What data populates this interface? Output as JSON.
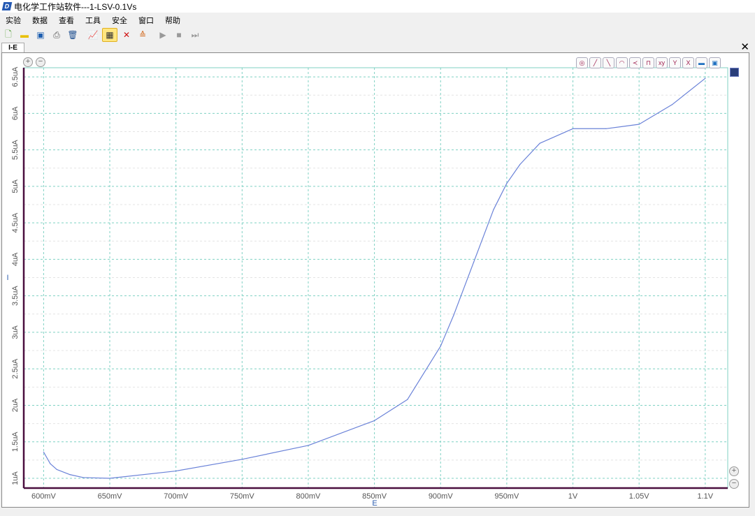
{
  "window": {
    "title": "电化学工作站软件---1-LSV-0.1Vs"
  },
  "menu": [
    "实验",
    "数据",
    "查看",
    "工具",
    "安全",
    "窗口",
    "帮助"
  ],
  "toolbar": [
    "new-icon",
    "open-icon",
    "save-icon",
    "print-icon",
    "delete-icon",
    "chart-icon",
    "grid-icon",
    "cross-icon",
    "layers-icon",
    "play-icon",
    "stop-icon",
    "skip-icon"
  ],
  "tab": {
    "label": "I-E",
    "close": "✕"
  },
  "plot_tools": [
    "target-icon",
    "line-icon",
    "slope-icon",
    "arc-icon",
    "merge-icon",
    "peak-icon",
    "xy-icon",
    "y-icon",
    "x-icon",
    "image-icon",
    "save-icon"
  ],
  "colors": {
    "curve": "#6a82d8",
    "grid": "#7fd1c3",
    "axis": "#4a0f3f",
    "label": "#2f5fb0"
  },
  "chart_data": {
    "type": "line",
    "xlabel": "E",
    "ylabel": "I",
    "xlim": [
      585,
      1117
    ],
    "ylim": [
      0.866,
      6.625
    ],
    "x_ticks": [
      600,
      650,
      700,
      750,
      800,
      850,
      900,
      950,
      1000,
      1050,
      1100
    ],
    "x_tick_labels": [
      "600mV",
      "650mV",
      "700mV",
      "750mV",
      "800mV",
      "850mV",
      "900mV",
      "950mV",
      "1V",
      "1.05V",
      "1.1V"
    ],
    "y_ticks": [
      1,
      1.5,
      2,
      2.5,
      3,
      3.5,
      4,
      4.5,
      5,
      5.5,
      6,
      6.5
    ],
    "y_tick_labels": [
      "1uA",
      "1.5uA",
      "2uA",
      "2.5uA",
      "3uA",
      "3.5uA",
      "4uA",
      "4.5uA",
      "5uA",
      "5.5uA",
      "6uA",
      "6.5uA"
    ],
    "grid": true,
    "x": [
      600,
      605,
      610,
      620,
      630,
      650,
      700,
      750,
      800,
      850,
      875,
      900,
      910,
      925,
      940,
      950,
      960,
      975,
      1000,
      1025,
      1050,
      1075,
      1100
    ],
    "y": [
      1.36,
      1.2,
      1.12,
      1.05,
      1.01,
      1.0,
      1.1,
      1.26,
      1.45,
      1.79,
      2.08,
      2.81,
      3.24,
      3.96,
      4.68,
      5.04,
      5.3,
      5.59,
      5.79,
      5.79,
      5.85,
      6.12,
      6.48
    ]
  }
}
